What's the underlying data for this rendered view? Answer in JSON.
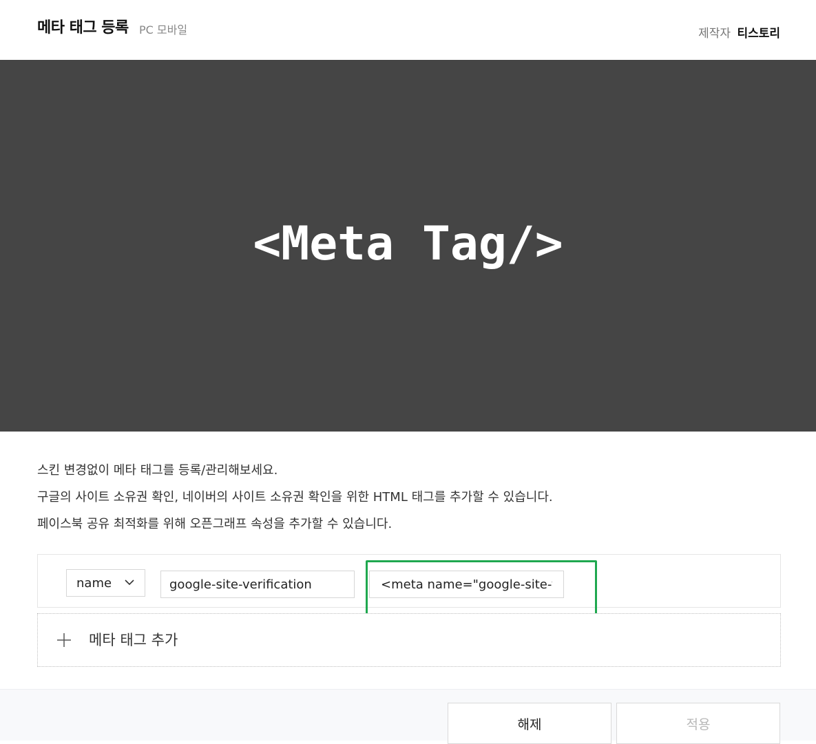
{
  "header": {
    "title": "메타 태그 등록",
    "platform": "PC 모바일",
    "maker_label": "제작자",
    "maker_name": "티스토리"
  },
  "banner": {
    "text": "<Meta Tag/>",
    "background_color": "#454545"
  },
  "description": {
    "lines": [
      "스킨 변경없이 메타 태그를 등록/관리해보세요.",
      "구글의 사이트 소유권 확인, 네이버의 사이트 소유권 확인을 위한 HTML 태그를 추가할 수 있습니다.",
      "페이스북 공유 최적화를 위해 오픈그래프 속성을 추가할 수 있습니다."
    ]
  },
  "meta_row": {
    "attribute_select": "name",
    "name_value": "google-site-verification",
    "content_value": "<meta name=\"google-site-verification\""
  },
  "add_row": {
    "label": "메타 태그 추가",
    "icon": "plus-icon"
  },
  "footer": {
    "release_label": "해제",
    "apply_label": "적용"
  },
  "colors": {
    "highlight": "#1fa84f",
    "disabled_text": "#b8b8b8"
  }
}
